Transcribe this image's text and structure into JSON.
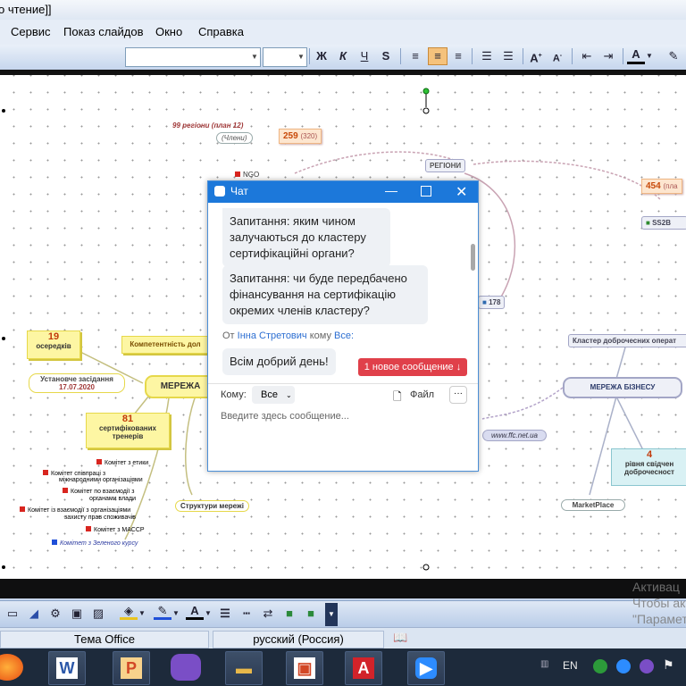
{
  "app": {
    "title_fragment": "о чтение]]"
  },
  "menu": {
    "items": [
      "Сервис",
      "Показ слайдов",
      "Окно",
      "Справка"
    ]
  },
  "toolbar": {
    "buttons": [
      "Ж",
      "К",
      "Ч",
      "S"
    ],
    "font_name_value": "",
    "font_size_value": ""
  },
  "status_bar": {
    "theme": "Тема Office",
    "language": "русский (Россия)"
  },
  "taskbar": {
    "language": "EN",
    "apps": [
      "firefox-icon",
      "word-icon",
      "powerpoint-icon",
      "viber-icon",
      "explorer-icon",
      "impress-icon",
      "acrobat-icon",
      "zoom-icon"
    ]
  },
  "watermark": {
    "line1": "Активац",
    "line2": "Чтобы акт",
    "line3": "\"Параметр"
  },
  "mindmap": {
    "regions_label": "99 регіони (план 12)",
    "chamber_label": "(Члени)",
    "badge_259": "259",
    "badge_259_sub": "(320)",
    "ngo_label": "NGO",
    "regions_box": "РЕГІОНИ",
    "badge_454": "454",
    "badge_454_sub": "(пла",
    "b2b_label": "SS2B",
    "b2b_count": "2",
    "top_node": "178",
    "centers_number": "19",
    "centers_label": "осередків",
    "founding_meeting": "Установче засідання",
    "founding_date": "17.07.2020",
    "competence_label": "Компетентність дол",
    "network_node": "МЕРЕЖА",
    "certified_number": "81",
    "certified_label1": "сертифікованих",
    "certified_label2": "тренерів",
    "business_network": "МЕРЕЖА БІЗНЕСУ",
    "cluster_label": "Кластер доброчесних операт",
    "site_label": "www.ffc.net.ua",
    "levels_number": "4",
    "levels_label1": "рівня свідчен",
    "levels_label2": "доброчесност",
    "marketplace": "MarketPlace",
    "network_structures": "Структури мережі",
    "committees": [
      "Комітет з етики",
      "Комітет співпраці з",
      "міжнародними організаціями",
      "Комітет по взаємодії з",
      "органами влади",
      "Комітет із взаємодії з організаціями",
      "захисту прав споживачів",
      "Комітет з МАССР",
      "Комітет з Зеленого курсу"
    ]
  },
  "chat": {
    "title": "Чат",
    "messages": [
      "Запитання: яким чином залучаються до кластеру сертифікаційні органи?",
      "Запитання: чи буде передбачено фінансування на сертифікацію окремих членів кластеру?"
    ],
    "from_prefix": "От",
    "from_name": "Інна Стретович",
    "to_word": "кому",
    "to_all": "Все:",
    "last_message": "Всім добрий день!",
    "new_message_badge": "1 новое сообщение",
    "recipient_label": "Кому:",
    "recipient_value": "Все",
    "file_label": "Файл",
    "more_label": "···",
    "input_placeholder": "Введите здесь сообщение..."
  }
}
